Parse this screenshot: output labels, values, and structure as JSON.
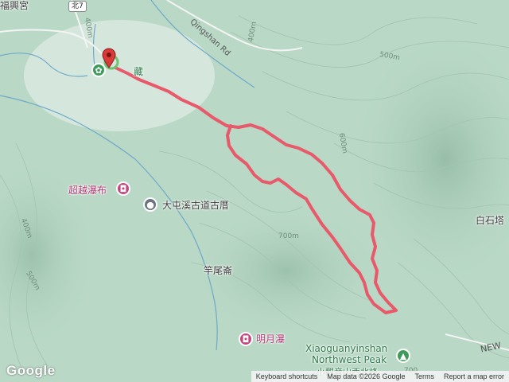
{
  "map": {
    "colors": {
      "terrain": "#b9d8c6",
      "route": "#e8596a",
      "water": "#6fa9c9"
    },
    "labels": {
      "temple": "福興宮",
      "road_badge": "北7",
      "qingshan_rd": "Qingshan Rd",
      "start_poi": "藏",
      "waterfall_chaoyue": "超越瀑布",
      "ancient_trail": "大屯溪古道古厝",
      "ganweiling": "竿尾崙",
      "mingyue_waterfall": "明月瀑",
      "peak_en_1": "Xiaoguanyinshan",
      "peak_en_2": "Northwest Peak",
      "peak_zh": "小觀音山西北峰",
      "baishita": "白石塔",
      "new_road": "NEW"
    },
    "contours": {
      "c400a": "400m",
      "c500": "500m",
      "c600": "600m",
      "c700": "700m",
      "c400b": "400m",
      "c500b": "500m",
      "c700b": "700"
    },
    "icons": {
      "pin": "map-pin-icon",
      "flower": "flower-icon",
      "camera": "camera-icon",
      "landmark": "landmark-icon",
      "mountain": "mountain-icon"
    }
  },
  "footer": {
    "keyboard": "Keyboard shortcuts",
    "mapdata": "Map data ©2026 Google",
    "terms": "Terms",
    "report": "Report a map error"
  },
  "brand": {
    "logo": "Google"
  }
}
